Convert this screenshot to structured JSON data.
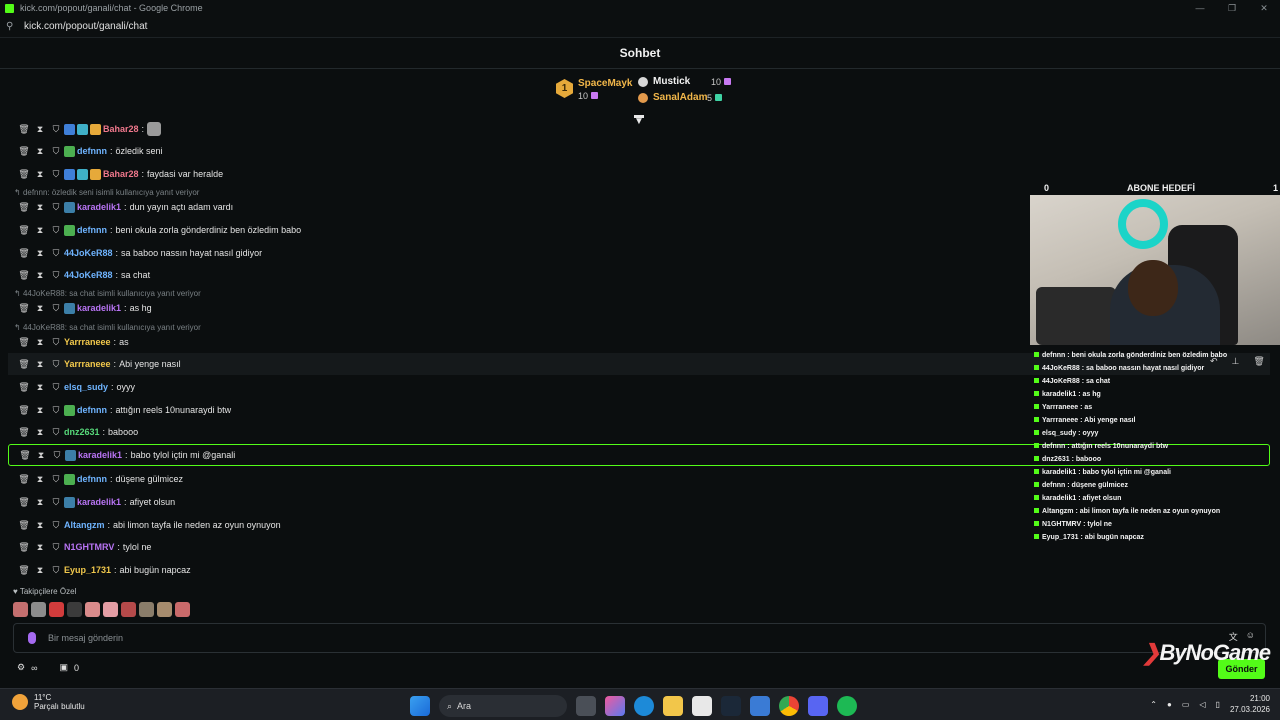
{
  "window": {
    "title": "kick.com/popout/ganali/chat - Google Chrome",
    "url": "kick.com/popout/ganali/chat"
  },
  "chat": {
    "header": "Sohbet"
  },
  "leaderboard": {
    "first": {
      "name": "SpaceMayk",
      "count": "10",
      "rank": "1"
    },
    "rows": [
      {
        "name": "Mustick",
        "count": "10"
      },
      {
        "name": "SanalAdam",
        "count": "5"
      }
    ]
  },
  "colors": {
    "accent": "#53fc18",
    "gold": "#f2b74a",
    "purple": "#a56af0"
  },
  "messages": [
    {
      "user": "Bahar28",
      "text": "",
      "color": "#f0788c"
    },
    {
      "user": "defnnn",
      "text": "özledik seni",
      "color": "#6fb4ff"
    },
    {
      "user": "Bahar28",
      "text": "faydasi var heralde",
      "color": "#f0788c"
    },
    {
      "user": "karadelik1",
      "text": "dun yayın açtı adam vardı",
      "color": "#b874f4"
    },
    {
      "user": "defnnn",
      "text": "beni okula zorla gönderdiniz ben özledim babo",
      "color": "#6fb4ff"
    },
    {
      "user": "44JoKeR88",
      "text": "sa baboo nassın hayat nasıl gidiyor",
      "color": "#6fb4ff"
    },
    {
      "user": "44JoKeR88",
      "text": "sa chat",
      "color": "#6fb4ff"
    },
    {
      "user": "karadelik1",
      "text": "as hg",
      "color": "#b874f4"
    },
    {
      "user": "Yarrraneee",
      "text": "as",
      "color": "#f2c94c"
    },
    {
      "user": "Yarrraneee",
      "text": "Abi yenge nasıl",
      "color": "#f2c94c"
    },
    {
      "user": "elsq_sudy",
      "text": "oyyy",
      "color": "#6fb4ff"
    },
    {
      "user": "defnnn",
      "text": "attığın reels 10nunaraydi btw",
      "color": "#6fb4ff"
    },
    {
      "user": "dnz2631",
      "text": "babooo",
      "color": "#57d97a"
    },
    {
      "user": "karadelik1",
      "text": "babo tylol içtin mi @ganali",
      "color": "#b874f4"
    },
    {
      "user": "defnnn",
      "text": "düşene gülmicez",
      "color": "#6fb4ff"
    },
    {
      "user": "karadelik1",
      "text": "afiyet olsun",
      "color": "#b874f4"
    },
    {
      "user": "Altangzm",
      "text": "abi limon tayfa ile neden az oyun oynuyon",
      "color": "#6fb4ff"
    },
    {
      "user": "N1GHTMRV",
      "text": "tylol ne",
      "color": "#b874f4"
    },
    {
      "user": "Eyup_1731",
      "text": "abi bugün napcaz",
      "color": "#f2c94c"
    }
  ],
  "replies": [
    "defnnn: özledik seni isimli kullanıcıya yanıt veriyor",
    "44JoKeR88: sa chat isimli kullanıcıya yanıt veriyor",
    "44JoKeR88: sa chat isimli kullanıcıya yanıt veriyor"
  ],
  "followers_label": "Takipçilere Özel",
  "input": {
    "placeholder": "Bir mesaj gönderin",
    "send_label": "Gönder"
  },
  "bottom": {
    "count": "0"
  },
  "overlay": {
    "goal_title": "ABONE HEDEFİ",
    "goal_left": "0",
    "goal_right": "1",
    "lines": [
      "defnnn : beni okula zorla gönderdiniz ben özledim babo",
      "44JoKeR88 : sa baboo nassın hayat nasıl gidiyor",
      "44JoKeR88 : sa chat",
      "karadelik1 : as hg",
      "Yarrraneee : as",
      "Yarrraneee : Abi yenge nasıl",
      "elsq_sudy : oyyy",
      "defnnn : attığın reels 10nunaraydi btw",
      "dnz2631 : babooo",
      "karadelik1 : babo tylol içtin mi @ganali",
      "defnnn : düşene gülmicez",
      "karadelik1 : afiyet olsun",
      "Altangzm : abi limon tayfa ile neden az oyun oynuyon",
      "N1GHTMRV : tylol ne",
      "Eyup_1731 : abi bugün napcaz"
    ],
    "brand": "ByNoGame"
  },
  "taskbar": {
    "weather_temp": "11°C",
    "weather_desc": "Parçalı bulutlu",
    "search": "Ara",
    "time": "21:00",
    "date": "27.03.2026"
  }
}
